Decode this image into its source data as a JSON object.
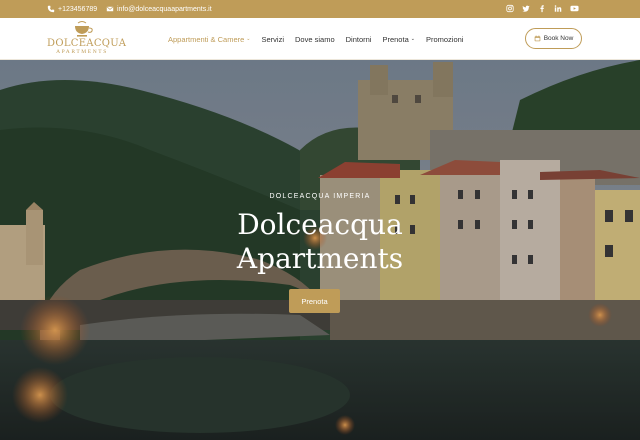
{
  "topbar": {
    "phone": "+123456789",
    "email": "info@dolceacquaapartments.it",
    "social_icons": [
      "instagram-icon",
      "twitter-icon",
      "facebook-icon",
      "linkedin-icon",
      "youtube-icon"
    ]
  },
  "brand": {
    "name": "DOLCEACQUA",
    "tagline": "APARTMENTS",
    "color": "#bf9c58"
  },
  "nav": {
    "items": [
      {
        "label": "Appartmenti & Camere",
        "dropdown": true,
        "active": true
      },
      {
        "label": "Servizi",
        "dropdown": false
      },
      {
        "label": "Dove siamo",
        "dropdown": false
      },
      {
        "label": "Dintorni",
        "dropdown": false
      },
      {
        "label": "Prenota",
        "dropdown": true
      },
      {
        "label": "Promozioni",
        "dropdown": false
      }
    ],
    "book_label": "Book Now"
  },
  "hero": {
    "kicker": "DOLCEACQUA IMPERIA",
    "title_line1": "Dolceacqua",
    "title_line2": "Apartments",
    "cta_label": "Prenota"
  }
}
